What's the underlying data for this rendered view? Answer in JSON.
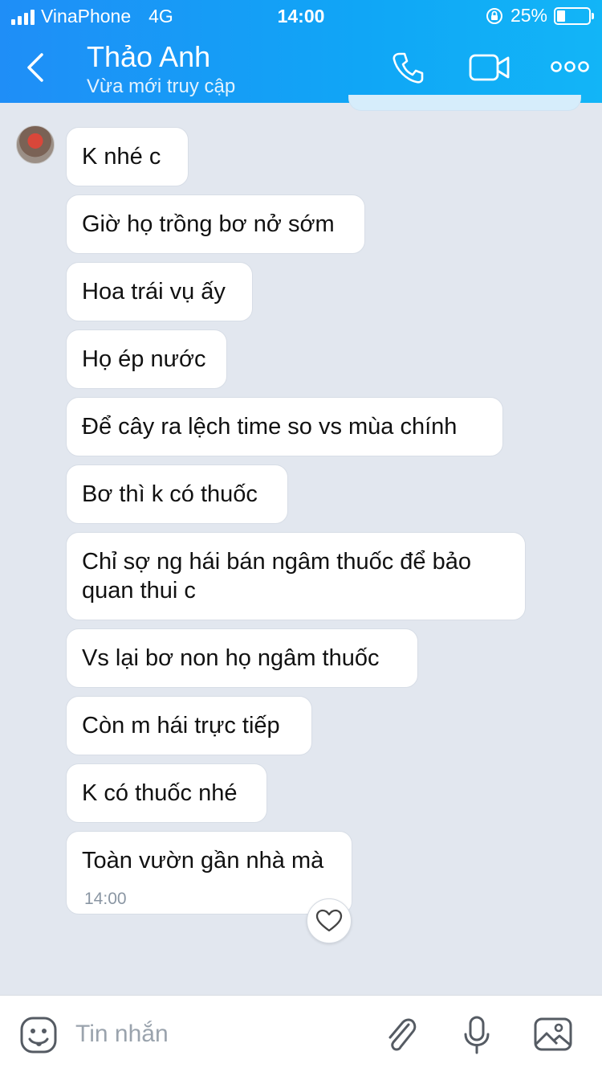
{
  "status": {
    "carrier": "VinaPhone",
    "network": "4G",
    "time": "14:00",
    "battery": "25%"
  },
  "header": {
    "title": "Thảo Anh",
    "subtitle": "Vừa mới truy cập"
  },
  "messages": [
    "K nhé c",
    "Giờ họ trồng bơ nở sớm",
    "Hoa trái vụ ấy",
    "Họ ép nước",
    "Để cây ra lệch time so vs mùa chính",
    "Bơ thì k có thuốc",
    "Chỉ sợ ng hái bán ngâm thuốc để bảo quan thui c",
    "Vs lại bơ non họ ngâm thuốc",
    "Còn m hái trực tiếp",
    "K có thuốc nhé",
    "Toàn vườn gần nhà mà"
  ],
  "last_message_time": "14:00",
  "composer": {
    "placeholder": "Tin nhắn"
  },
  "colors": {
    "header_start": "#1f8ef7",
    "header_end": "#12b5f7",
    "chat_bg": "#e2e7ef",
    "icon_gray": "#555b63"
  }
}
